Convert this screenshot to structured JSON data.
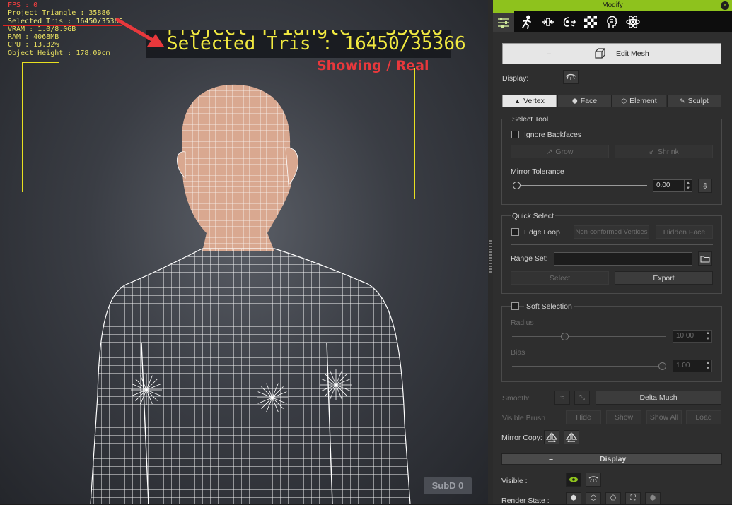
{
  "viewport": {
    "hud": {
      "fps": "FPS : 0",
      "project_triangle": "Project Triangle : 35886",
      "selected_tris": "Selected Tris : 16450/35366",
      "vram": "VRAM : 1.0/8.0GB",
      "ram": "RAM : 4068MB",
      "cpu": "CPU : 13.32%",
      "object_height": "Object Height : 178.09cm"
    },
    "zoom_overlay": {
      "partial_line": "Project Triangle : 35886",
      "selected_line": "Selected Tris : 16450/35366"
    },
    "annotation": "Showing / Real",
    "subd": "SubD 0",
    "colors": {
      "hud": "#e8e060",
      "annotation": "#e8383c",
      "fps": "#ff4040"
    }
  },
  "panel": {
    "title": "Modify",
    "close_icon": "×",
    "tabs": [
      {
        "name": "sliders-icon",
        "active": true
      },
      {
        "name": "motion-icon"
      },
      {
        "name": "transform-icon"
      },
      {
        "name": "morph-icon"
      },
      {
        "name": "checker-icon"
      },
      {
        "name": "head-icon"
      },
      {
        "name": "atom-icon"
      }
    ],
    "edit_mesh": {
      "label": "Edit Mesh",
      "collapse": "–"
    },
    "display_label": "Display:",
    "mode_tabs": [
      "Vertex",
      "Face",
      "Element",
      "Sculpt"
    ],
    "select_tool": {
      "title": "Select Tool",
      "ignore_backfaces": "Ignore Backfaces",
      "grow": "Grow",
      "shrink": "Shrink",
      "mirror_tolerance": "Mirror Tolerance",
      "tolerance_value": "0.00"
    },
    "quick_select": {
      "title": "Quick Select",
      "edge_loop": "Edge Loop",
      "non_conformed": "Non-conformed Vertices",
      "hidden_face": "Hidden Face",
      "range_set": "Range Set:",
      "select": "Select",
      "export": "Export"
    },
    "soft_selection": {
      "title": "Soft Selection",
      "radius": "Radius",
      "radius_value": "10.00",
      "bias": "Bias",
      "bias_value": "1.00"
    },
    "smooth": "Smooth:",
    "delta_mush": "Delta Mush",
    "visible_brush": "Visible Brush",
    "hide": "Hide",
    "show": "Show",
    "show_all": "Show All",
    "load": "Load",
    "mirror_copy": "Mirror Copy:",
    "display_section": {
      "title": "Display",
      "collapse": "–"
    },
    "visible": "Visible :",
    "render_state": "Render State :",
    "accent": "#8ec21d"
  }
}
